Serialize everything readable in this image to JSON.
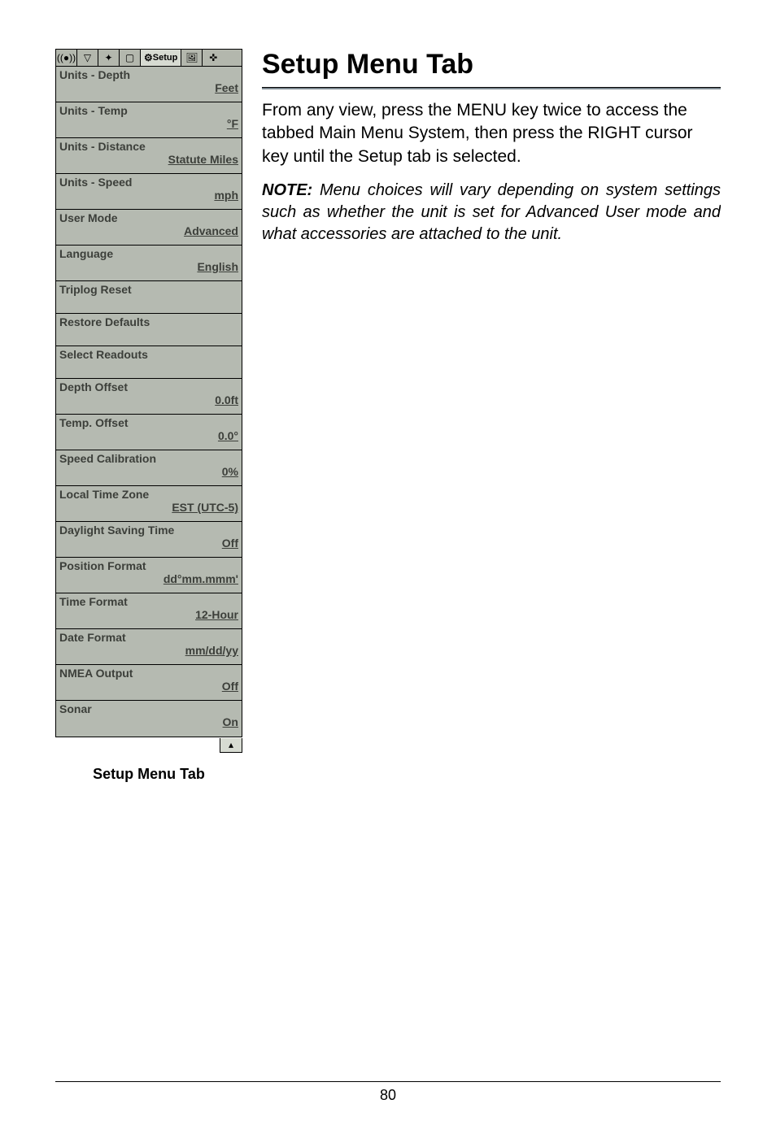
{
  "tabs": {
    "icon0": "((●))",
    "icon1": "▽",
    "icon2": "✦",
    "icon3": "▢",
    "setup_icon": "⚙",
    "setup_label": "Setup",
    "icon5": "🖼",
    "icon6": "✜"
  },
  "menu": {
    "items": [
      {
        "label": "Units - Depth",
        "value": "Feet"
      },
      {
        "label": "Units - Temp",
        "value": "°F"
      },
      {
        "label": "Units - Distance",
        "value": "Statute Miles"
      },
      {
        "label": "Units - Speed",
        "value": "mph"
      },
      {
        "label": "User Mode",
        "value": "Advanced"
      },
      {
        "label": "Language",
        "value": "English"
      },
      {
        "label": "Triplog Reset",
        "value": ""
      },
      {
        "label": "Restore Defaults",
        "value": ""
      },
      {
        "label": "Select Readouts",
        "value": ""
      },
      {
        "label": "Depth Offset",
        "value": "0.0ft"
      },
      {
        "label": "Temp. Offset",
        "value": "0.0°"
      },
      {
        "label": "Speed Calibration",
        "value": "0%"
      },
      {
        "label": "Local Time Zone",
        "value": "EST (UTC-5)"
      },
      {
        "label": "Daylight Saving Time",
        "value": "Off"
      },
      {
        "label": "Position Format",
        "value": "dd°mm.mmm'"
      },
      {
        "label": "Time Format",
        "value": "12-Hour"
      },
      {
        "label": "Date Format",
        "value": "mm/dd/yy"
      },
      {
        "label": "NMEA Output",
        "value": "Off"
      },
      {
        "label": "Sonar",
        "value": "On"
      }
    ],
    "scroll_glyph": "▴"
  },
  "screenshot_caption": "Setup Menu Tab",
  "title": "Setup Menu Tab",
  "paragraph": "From any view, press the MENU key twice to access the tabbed Main Menu System, then press the RIGHT cursor key until the Setup tab is selected.",
  "note_lead": "NOTE:",
  "note_body": " Menu choices will vary depending on system settings such as whether the unit is set for Advanced User mode and what accessories are attached to the unit.",
  "page_number": "80"
}
